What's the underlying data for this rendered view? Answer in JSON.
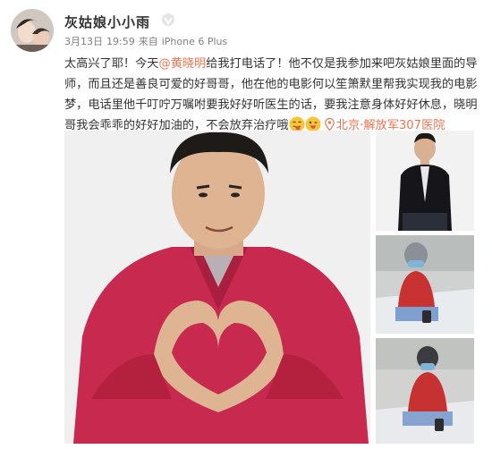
{
  "post": {
    "author": "灰姑娘小小雨",
    "date": "3月13日",
    "time": "19:59",
    "source_prefix": "来自",
    "device": "iPhone 6 Plus",
    "text": {
      "part1": "太高兴了耶！今天",
      "mention": "@黄晓明",
      "part2": "给我打电话了！他不仅是我参加来吧灰姑娘里面的导师，而且还是善良可爱的好哥哥，他在他的电影何以笙箫默里帮我实现我的电影梦，电话里他千叮咛万嘱咐要我好好听医生的话，要我注意身体好好休息，晓明哥我会乖乖的好好加油的，不会放弃治疗哦",
      "location": "北京·解放军307医院"
    },
    "emojis": [
      "tongue-out-emoji",
      "wink-emoji"
    ],
    "photos": [
      {
        "name": "photo-main-heart-hands"
      },
      {
        "name": "photo-man-black-jacket"
      },
      {
        "name": "photo-patient-on-phone-1"
      },
      {
        "name": "photo-patient-on-phone-2"
      }
    ]
  },
  "colors": {
    "accent": "#eb7350",
    "text": "#333333",
    "meta": "#808080",
    "shirt": "#c8294f"
  }
}
